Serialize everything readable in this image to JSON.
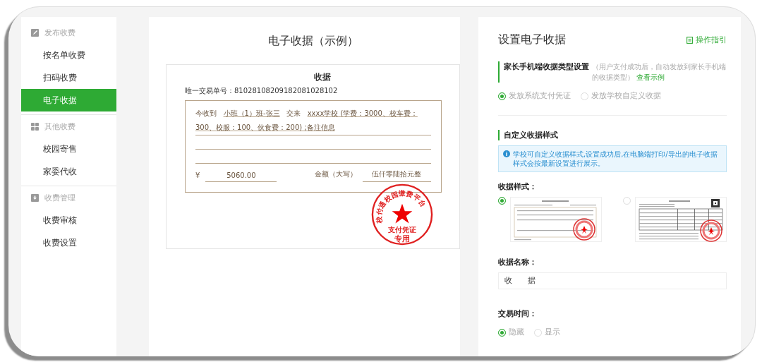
{
  "sidebar": {
    "groups": [
      {
        "kind": "edit",
        "title": "发布收费",
        "items": [
          {
            "label": "按名单收费",
            "selected": false
          },
          {
            "label": "扫码收费",
            "selected": false
          },
          {
            "label": "电子收据",
            "selected": true
          }
        ]
      },
      {
        "kind": "grid",
        "title": "其他收费",
        "items": [
          {
            "label": "校园寄售",
            "selected": false
          },
          {
            "label": "家委代收",
            "selected": false
          }
        ]
      },
      {
        "kind": "download",
        "title": "收费管理",
        "items": [
          {
            "label": "收费审核",
            "selected": false
          },
          {
            "label": "收费设置",
            "selected": false
          }
        ]
      }
    ]
  },
  "preview": {
    "title": "电子收据（示例）",
    "receipt": {
      "title": "收据",
      "serial_label": "唯一交易单号：",
      "serial": "81028108209182081028102",
      "body": [
        {
          "kind": "label",
          "text": "今收到"
        },
        {
          "kind": "value",
          "text": "小班（1）班-张三"
        },
        {
          "kind": "label",
          "text": "交来"
        },
        {
          "kind": "value",
          "text": "xxxx学校 (学费：3000、校车费：300、校服：100、伙食费：200) ;备注信息"
        }
      ],
      "currency": "¥",
      "amount": "5060.00",
      "amount_words_label": "金额（大写）",
      "amount_words": "伍仟零陆拾元整",
      "stamp": {
        "arc": "校付通校园缴费平台",
        "line_1": "支付凭证",
        "line_2": "专用"
      }
    }
  },
  "settings": {
    "title": "设置电子收据",
    "guide_link": "操作指引",
    "type_section": {
      "heading": "家长手机端收据类型设置",
      "note": "（用户支付成功后，自动发放到家长手机端的收据类型）",
      "link": "查看示例",
      "options": [
        {
          "label": "发放系统支付凭证",
          "selected": true
        },
        {
          "label": "发放学校自定义收据",
          "selected": false
        }
      ]
    },
    "style_section": {
      "heading": "自定义收据样式",
      "info": "学校可自定义收据样式,设置成功后,在电脑端打印/导出的电子收据样式会按最新设置进行展示。",
      "style_label": "收据样式：",
      "styles": [
        {
          "kind": "plain",
          "selected": true
        },
        {
          "kind": "table",
          "selected": false
        }
      ],
      "name_label": "收据名称：",
      "name_value": "收　　据",
      "time_label": "交易时间：",
      "time_options": [
        {
          "label": "隐藏",
          "selected": true
        },
        {
          "label": "显示",
          "selected": false
        }
      ]
    }
  }
}
